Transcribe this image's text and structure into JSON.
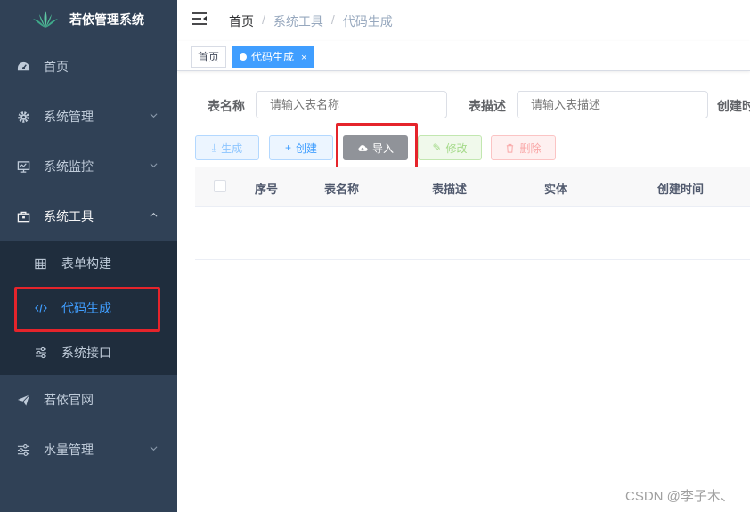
{
  "app": {
    "title": "若依管理系统"
  },
  "sidebar": {
    "items": [
      {
        "label": "首页",
        "icon": "dashboard-icon"
      },
      {
        "label": "系统管理",
        "icon": "gear-icon"
      },
      {
        "label": "系统监控",
        "icon": "monitor-icon"
      },
      {
        "label": "系统工具",
        "icon": "toolbox-icon"
      },
      {
        "label": "若依官网",
        "icon": "paper-plane-icon"
      },
      {
        "label": "水量管理",
        "icon": "sliders-icon"
      }
    ],
    "submenu": [
      {
        "label": "表单构建",
        "icon": "grid-icon"
      },
      {
        "label": "代码生成",
        "icon": "code-icon"
      },
      {
        "label": "系统接口",
        "icon": "sliders-icon"
      }
    ]
  },
  "breadcrumb": [
    "首页",
    "系统工具",
    "代码生成"
  ],
  "tags": [
    {
      "label": "首页"
    },
    {
      "label": "代码生成",
      "close": "×"
    }
  ],
  "search": {
    "table_name_label": "表名称",
    "table_name_placeholder": "请输入表名称",
    "table_desc_label": "表描述",
    "table_desc_placeholder": "请输入表描述",
    "create_time_label": "创建时间"
  },
  "toolbar": {
    "generate": "生成",
    "create": "创建",
    "import": "导入",
    "edit": "修改",
    "delete": "删除"
  },
  "table": {
    "columns": [
      "序号",
      "表名称",
      "表描述",
      "实体",
      "创建时间"
    ]
  },
  "watermark": "CSDN @李子木、",
  "colors": {
    "sidebar_bg": "#304156",
    "submenu_bg": "#1f2d3d",
    "accent": "#409eff",
    "highlight": "#e5242b"
  }
}
